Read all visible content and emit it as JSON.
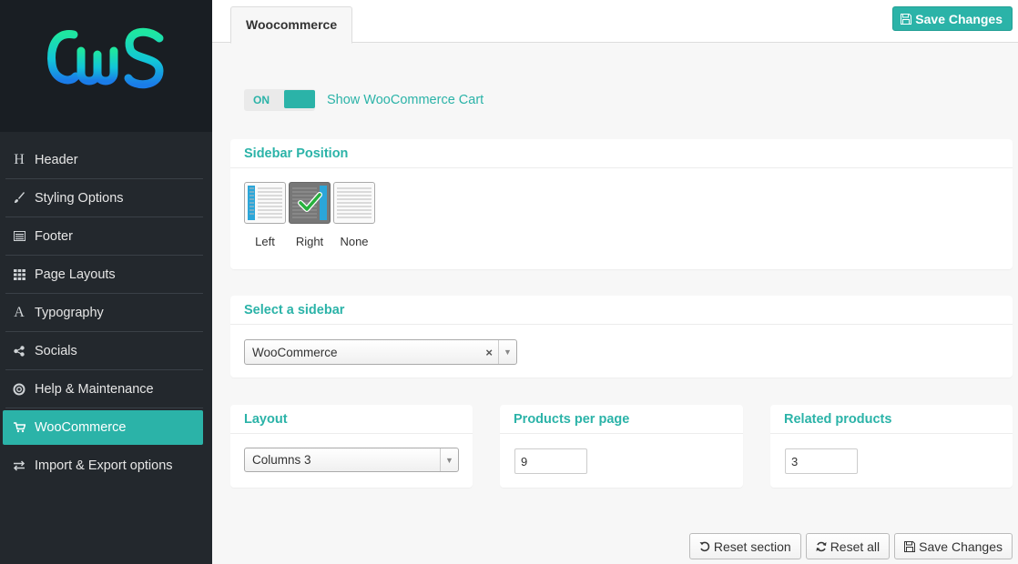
{
  "brand": {
    "accent": "#2bb3a8",
    "sidebar_bg": "#23282d",
    "logo_bg": "#191e23"
  },
  "sidebar": {
    "logo_alt": "CwS",
    "items": [
      {
        "label": "Header",
        "icon": "header-icon"
      },
      {
        "label": "Styling Options",
        "icon": "brush-icon"
      },
      {
        "label": "Footer",
        "icon": "footer-icon"
      },
      {
        "label": "Page Layouts",
        "icon": "grid-icon"
      },
      {
        "label": "Typography",
        "icon": "font-icon"
      },
      {
        "label": "Socials",
        "icon": "share-icon"
      },
      {
        "label": "Help & Maintenance",
        "icon": "lifebuoy-icon"
      },
      {
        "label": "WooCommerce",
        "icon": "cart-icon",
        "active": true
      },
      {
        "label": "Import & Export options",
        "icon": "exchange-icon"
      }
    ]
  },
  "header": {
    "tab_label": "Woocommerce",
    "save_label": "Save Changes"
  },
  "main": {
    "toggle": {
      "state": "ON",
      "label": "Show WooCommerce Cart"
    },
    "sidebar_position": {
      "title": "Sidebar Position",
      "options": [
        "Left",
        "Right",
        "None"
      ],
      "selected": "Right"
    },
    "select_sidebar": {
      "title": "Select a sidebar",
      "value": "WooCommerce"
    },
    "layout": {
      "title": "Layout",
      "value": "Columns 3"
    },
    "products_per_page": {
      "title": "Products per page",
      "value": "9"
    },
    "related_products": {
      "title": "Related products",
      "value": "3"
    }
  },
  "footer": {
    "reset_section": "Reset section",
    "reset_all": "Reset all",
    "save_changes": "Save Changes"
  }
}
